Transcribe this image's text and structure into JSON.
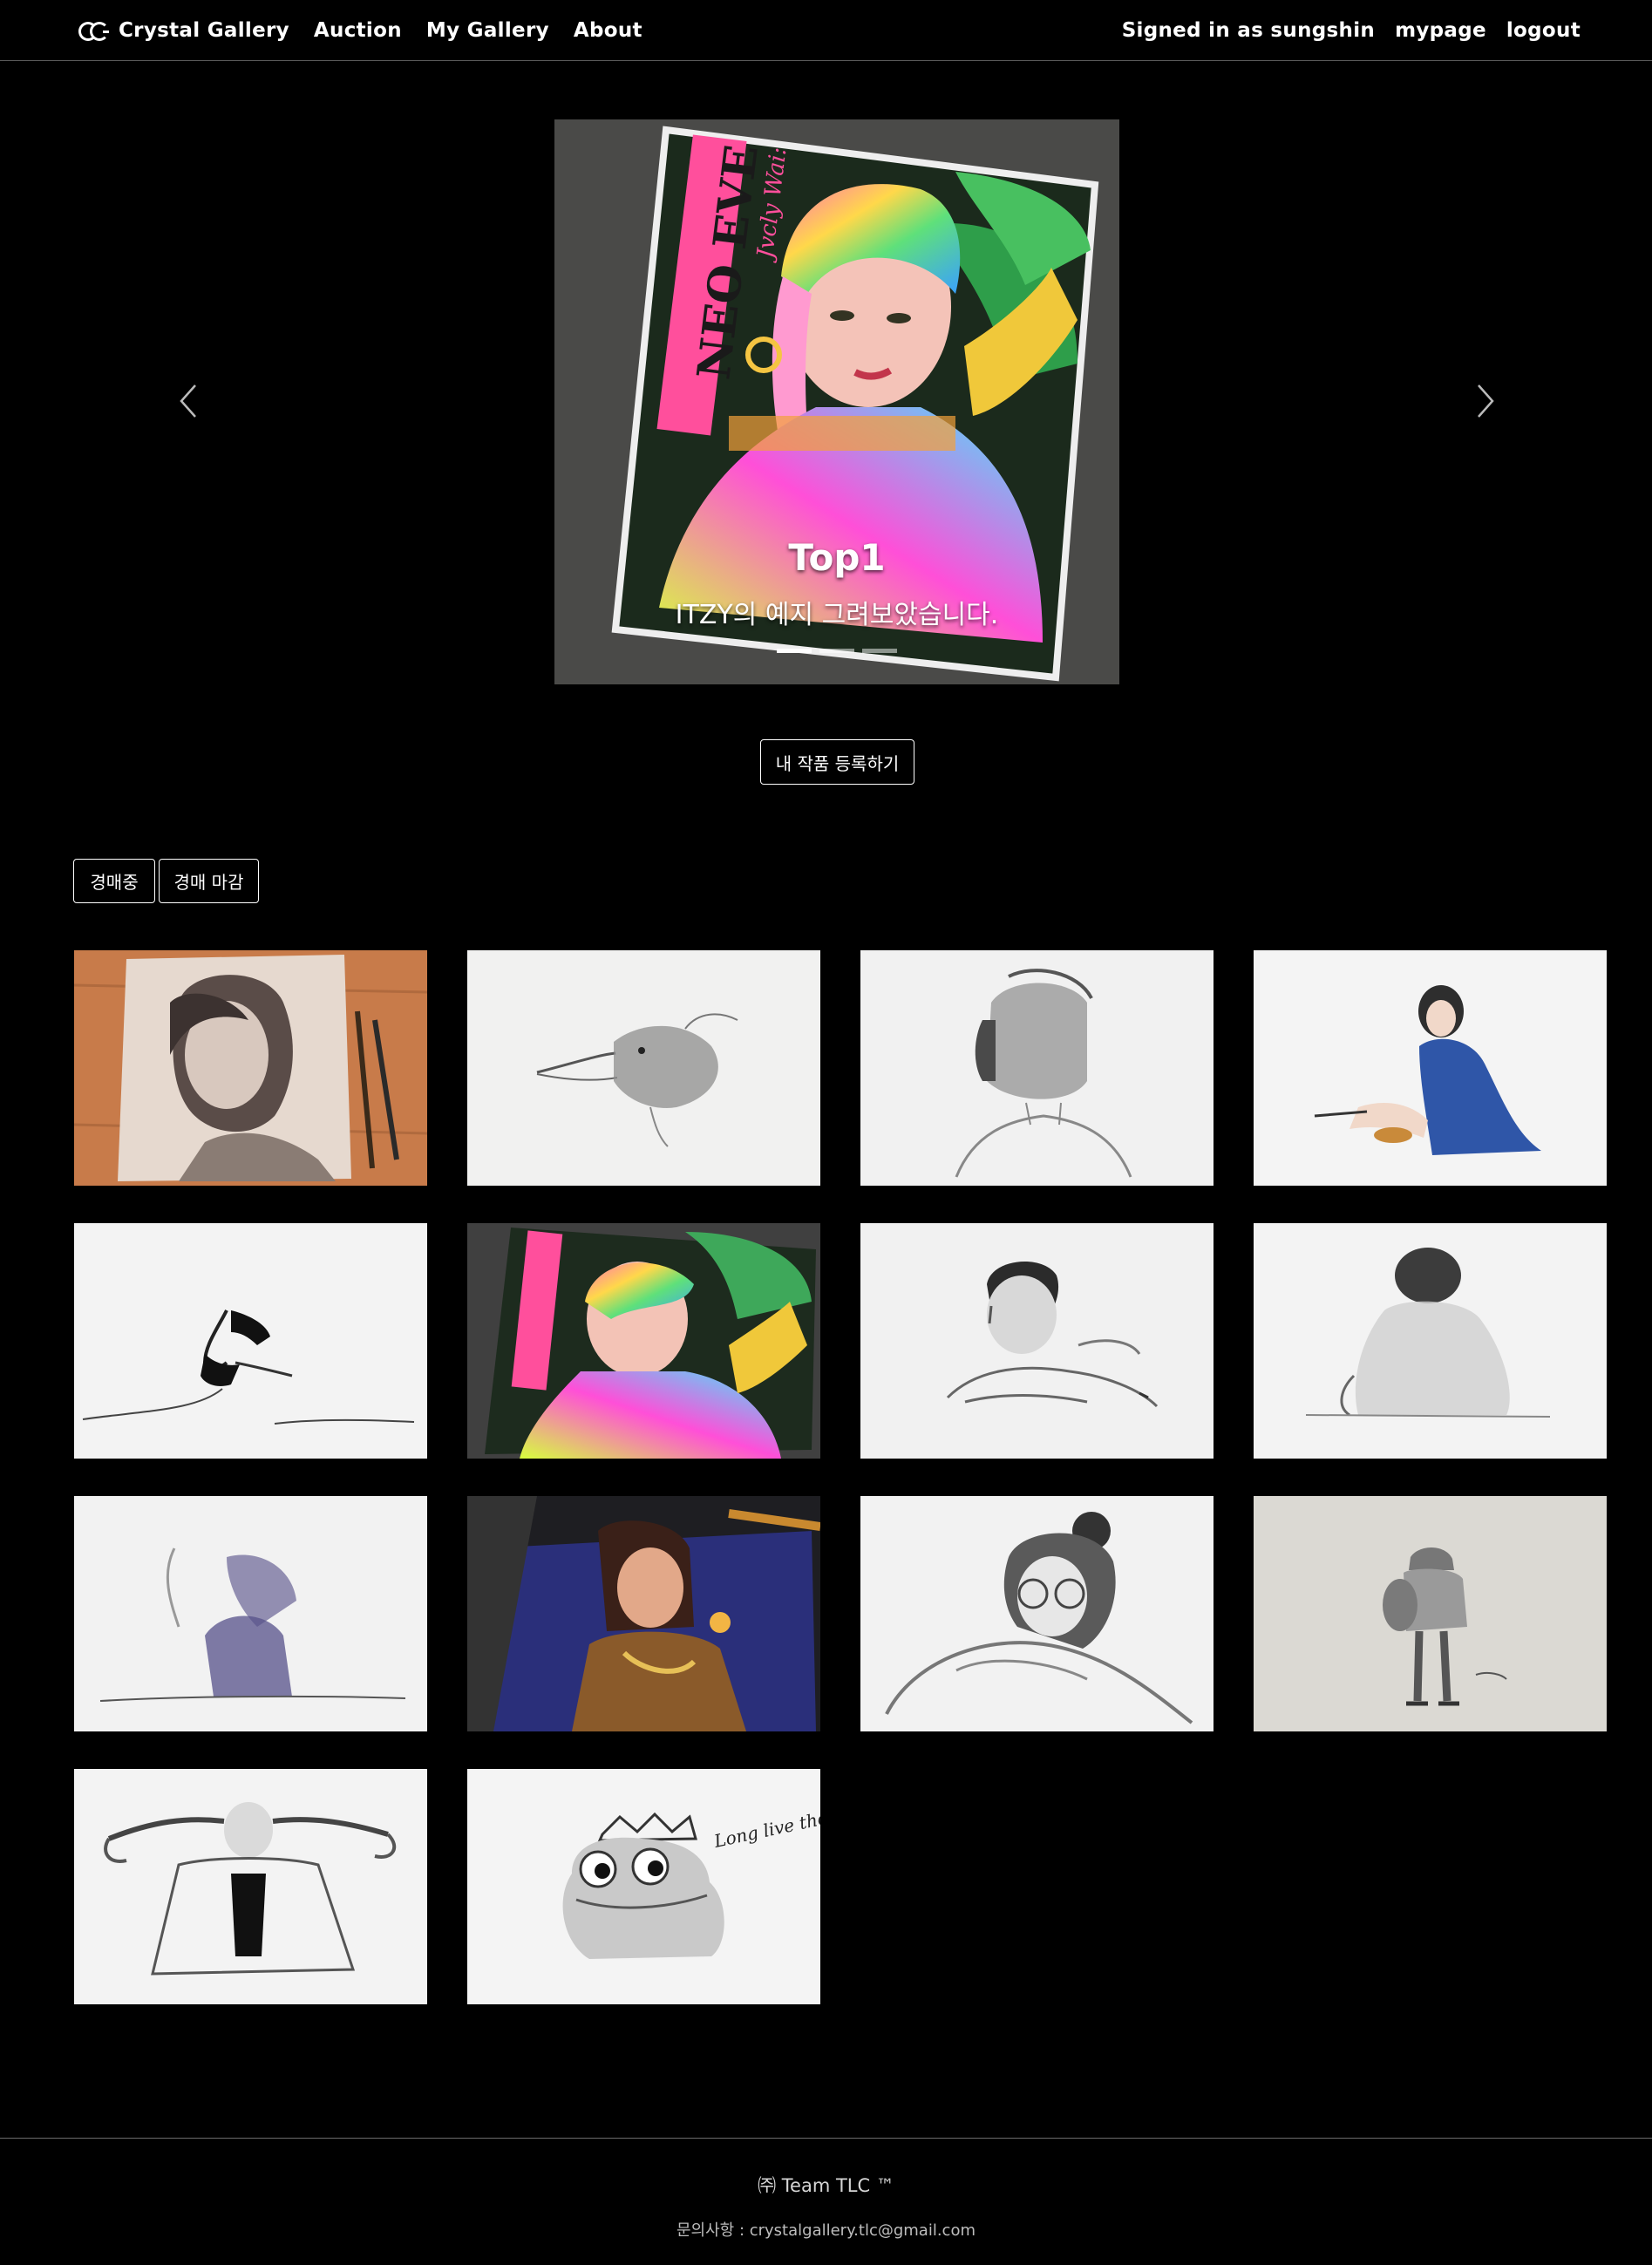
{
  "nav": {
    "brand": "Crystal Gallery",
    "links": [
      "Auction",
      "My Gallery",
      "About"
    ],
    "signed_in": "Signed in as sungshin",
    "mypage": "mypage",
    "logout": "logout"
  },
  "carousel": {
    "slide_title": "Top1",
    "slide_caption": "ITZY의 예지 그려보았습니다.",
    "slide_count": 3,
    "active_index": 0,
    "poster_text_1": "NEO EVE",
    "poster_text_2": "Jvcly Wai:"
  },
  "register_button": "내 작품 등록하기",
  "filters": [
    "경매중",
    "경매 마감"
  ],
  "gallery": [
    {
      "subject": "woman portrait on wood table"
    },
    {
      "subject": "bird head sketch"
    },
    {
      "subject": "man profile sketch"
    },
    {
      "subject": "girl in blue coat sitting"
    },
    {
      "subject": "kissing lips sketch"
    },
    {
      "subject": "NEO EVE colored poster"
    },
    {
      "subject": "man resting chin sketch"
    },
    {
      "subject": "back of person sketch"
    },
    {
      "subject": "crouching smoking figure"
    },
    {
      "subject": "colored portrait on dark"
    },
    {
      "subject": "girl with glasses sketch"
    },
    {
      "subject": "child with backpack sketch"
    },
    {
      "subject": "girl holding braids sketch"
    },
    {
      "subject": "frog king sketch",
      "inscription": "Long live the King!"
    }
  ],
  "footer": {
    "team": "㈜ Team TLC ™",
    "contact": "문의사항 : crystalgallery.tlc@gmail.com"
  }
}
